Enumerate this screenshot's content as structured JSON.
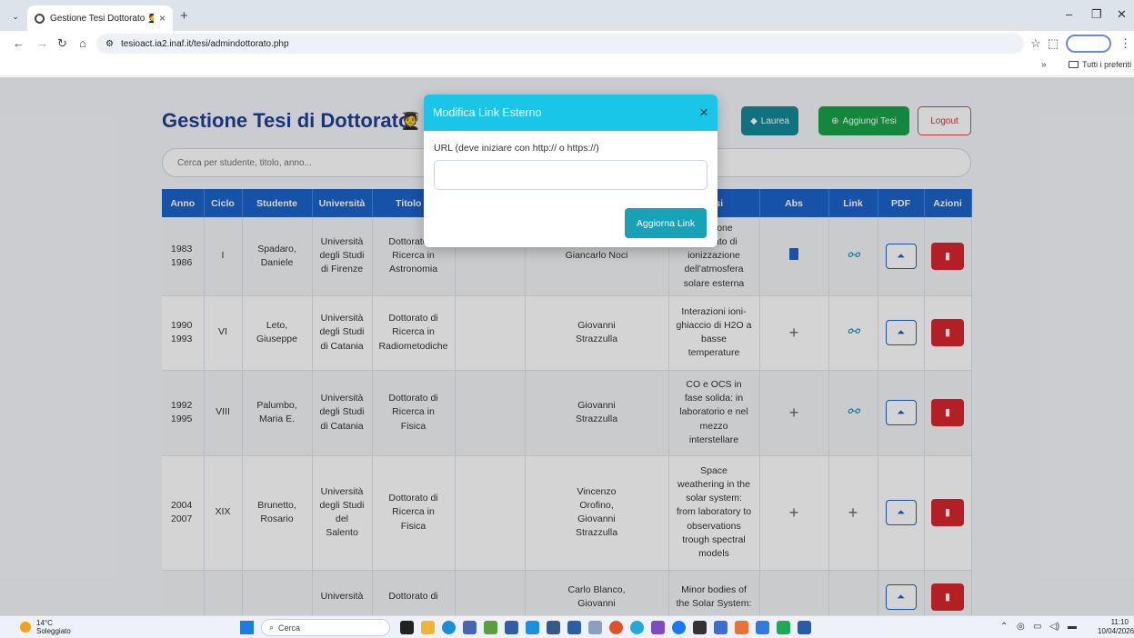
{
  "browser": {
    "tab_title": "Gestione Tesi Dottorato 🧑‍🎓",
    "tab_close": "×",
    "new_tab": "+",
    "url": "tesioact.ia2.inaf.it/tesi/admindottorato.php",
    "bookmarks_more": "»",
    "bookmarks_folder": "Tutti i preferiti"
  },
  "page": {
    "title": "Gestione Tesi di Dottorato",
    "title_emoji": "🧑‍🎓",
    "btn_laurea": "Laurea",
    "btn_add": "Aggiungi Tesi",
    "btn_logout": "Logout",
    "search_placeholder": "Cerca per studente, titolo, anno..."
  },
  "table": {
    "headers": [
      "Anno",
      "Ciclo",
      "Studente",
      "Università",
      "Titolo D",
      "",
      "",
      "",
      "Tesi",
      "Abs",
      "Link",
      "PDF",
      "Azioni"
    ],
    "rows": [
      {
        "anno": "1983\n1986",
        "ciclo": "I",
        "studente": "Spadaro,\nDaniele",
        "universita": "Università\ndegli Studi\ndi Firenze",
        "titolo": "Dottorato di\nRicerca in\nAstronomia",
        "relatore": "Giancarlo Noci",
        "tesi": "...sizione\n...e stato di\nionizzazione\ndell'atmosfera\nsolare esterna",
        "abs": "doc",
        "link": "link"
      },
      {
        "anno": "1990\n1993",
        "ciclo": "VI",
        "studente": "Leto,\nGiuseppe",
        "universita": "Università\ndegli Studi\ndi Catania",
        "titolo": "Dottorato di\nRicerca in\nRadiometodiche",
        "relatore": "Giovanni\nStrazzulla",
        "tesi": "Interazioni ioni-\nghiaccio di H2O a\nbasse\ntemperature",
        "abs": "+",
        "link": "link"
      },
      {
        "anno": "1992\n1995",
        "ciclo": "VIII",
        "studente": "Palumbo,\nMaria E.",
        "universita": "Università\ndegli Studi\ndi Catania",
        "titolo": "Dottorato di\nRicerca in\nFisica",
        "relatore": "Giovanni\nStrazzulla",
        "tesi": "CO e OCS in\nfase solida: in\nlaboratorio e nel\nmezzo\ninterstellare",
        "abs": "+",
        "link": "link"
      },
      {
        "anno": "2004\n2007",
        "ciclo": "XIX",
        "studente": "Brunetto,\nRosario",
        "universita": "Università\ndegli Studi\ndel\nSalento",
        "titolo": "Dottorato di\nRicerca in\nFisica",
        "relatore": "Vincenzo\nOrofino,\nGiovanni\nStrazzulla",
        "tesi": "Space\nweathering in the\nsolar system:\nfrom laboratory to\nobservations\ntrough spectral\nmodels",
        "abs": "+",
        "link": "+"
      },
      {
        "anno": "",
        "ciclo": "",
        "studente": "",
        "universita": "Università",
        "titolo": "Dottorato di",
        "relatore": "Carlo Blanco,\nGiovanni",
        "tesi": "Minor bodies of\nthe Solar System:",
        "abs": "",
        "link": ""
      }
    ]
  },
  "modal": {
    "title": "Modifica Link Esterno",
    "close": "×",
    "label": "URL (deve iniziare con http:// o https://)",
    "submit": "Aggiorna Link"
  },
  "taskbar": {
    "temp": "14°C",
    "weather": "Soleggiato",
    "search": "Cerca",
    "time": "11:10",
    "date": "10/04/2026"
  }
}
